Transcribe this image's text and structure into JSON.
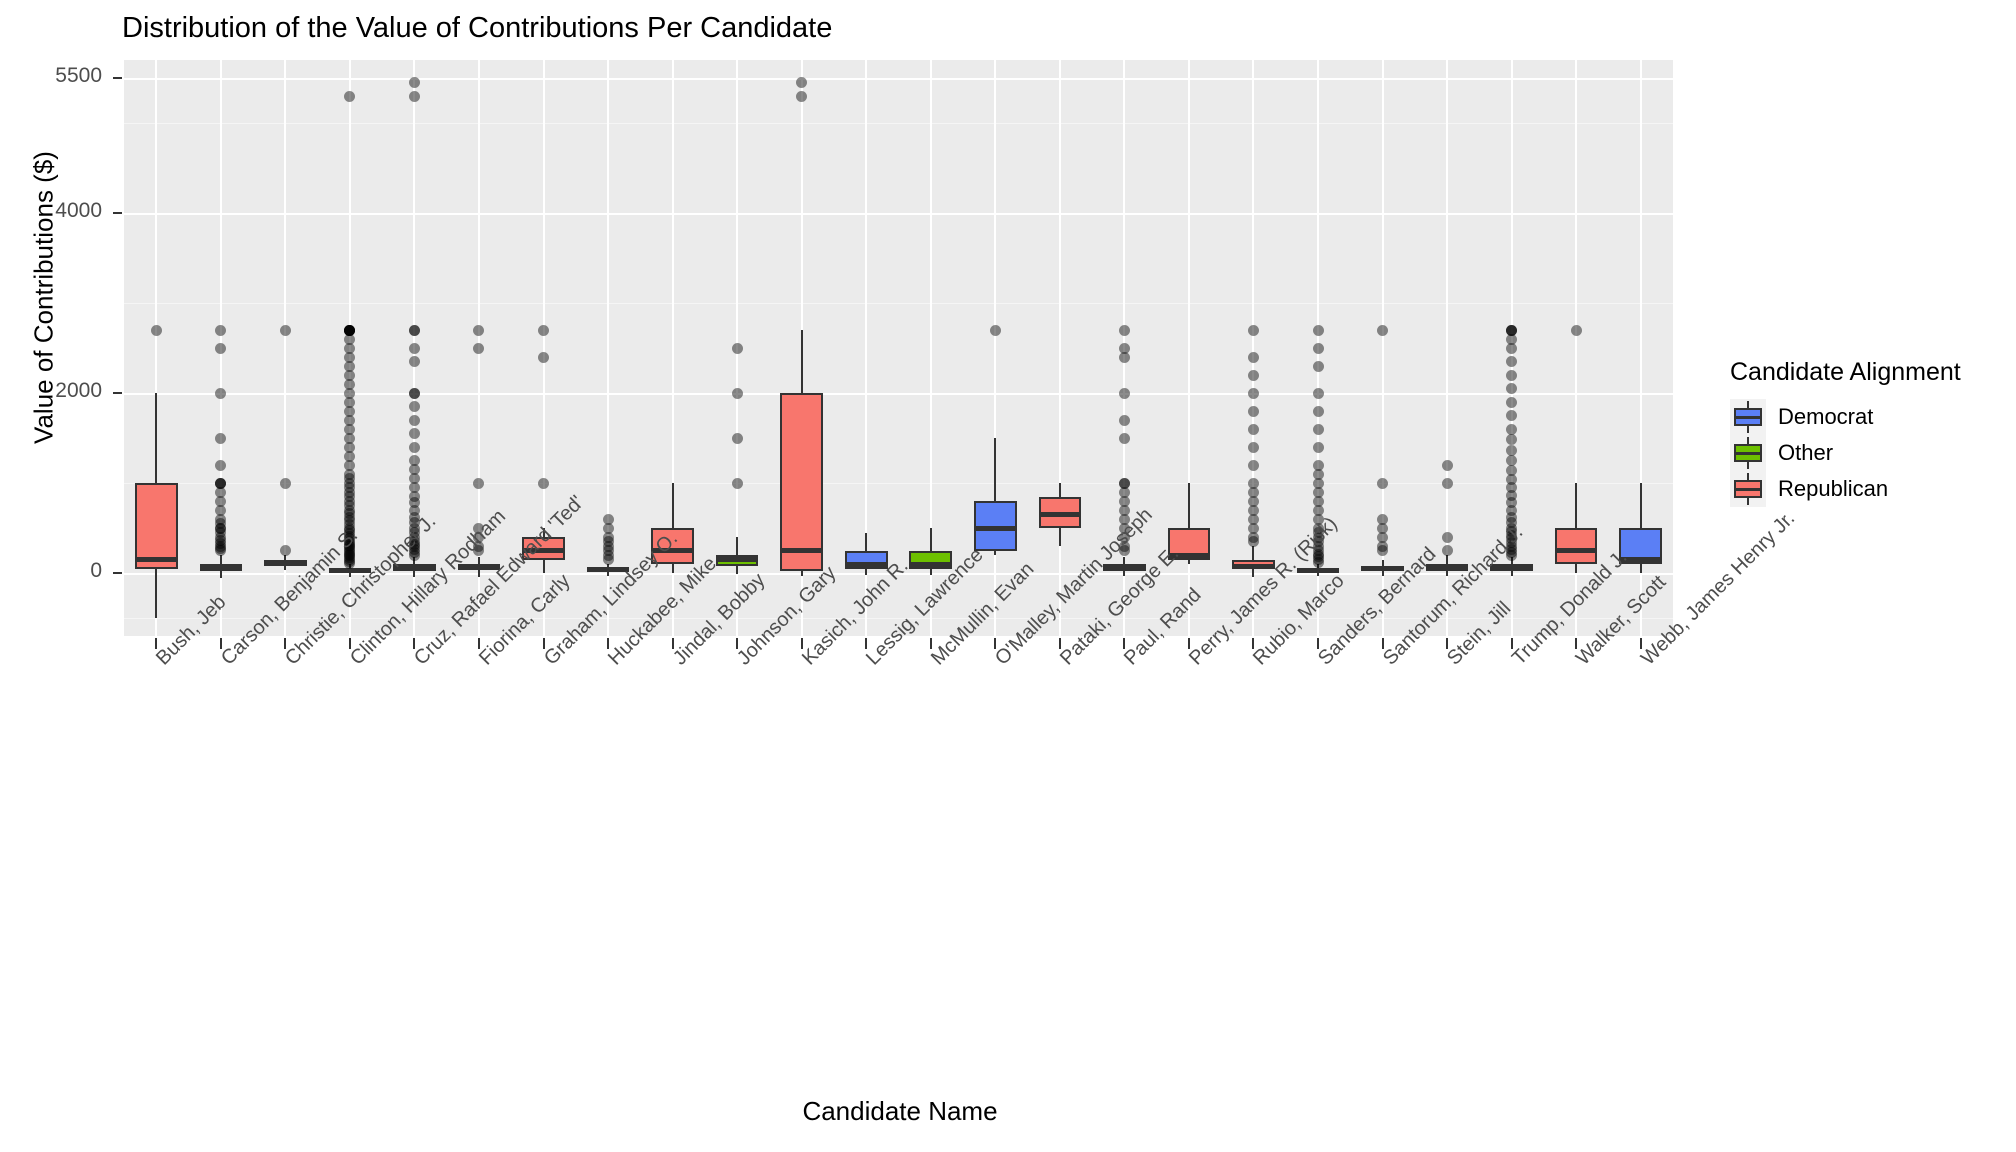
{
  "chart_data": {
    "type": "box",
    "title": "Distribution of the Value of Contributions Per Candidate",
    "xlabel": "Candidate Name",
    "ylabel": "Value of Contributions ($)",
    "ylim": [
      -700,
      5700
    ],
    "yticks": [
      0,
      2000,
      4000,
      5500
    ],
    "ytick_labels": [
      "0",
      "2000",
      "4000",
      "5500"
    ],
    "grid": true,
    "legend": {
      "title": "Candidate Alignment",
      "position": "right",
      "entries": [
        {
          "label": "Democrat",
          "color": "#5B7FF5"
        },
        {
          "label": "Other",
          "color": "#6DC000"
        },
        {
          "label": "Republican",
          "color": "#F8766D"
        }
      ]
    },
    "categories": [
      "Bush, Jeb",
      "Carson, Benjamin S.",
      "Christie, Christopher J.",
      "Clinton, Hillary Rodham",
      "Cruz, Rafael Edward 'Ted'",
      "Fiorina, Carly",
      "Graham, Lindsey O.",
      "Huckabee, Mike",
      "Jindal, Bobby",
      "Johnson, Gary",
      "Kasich, John R.",
      "Lessig, Lawrence",
      "McMullin, Evan",
      "O'Malley, Martin Joseph",
      "Pataki, George E.",
      "Paul, Rand",
      "Perry, James R. (Rick)",
      "Rubio, Marco",
      "Sanders, Bernard",
      "Santorum, Richard J.",
      "Stein, Jill",
      "Trump, Donald J.",
      "Walker, Scott",
      "Webb, James Henry Jr."
    ],
    "boxes": [
      {
        "category": "Bush, Jeb",
        "alignment": "Republican",
        "color": "#F8766D",
        "whisker_low": -500,
        "q1": 50,
        "median": 150,
        "q3": 1000,
        "whisker_high": 2000,
        "outliers": [
          2700
        ]
      },
      {
        "category": "Carson, Benjamin S.",
        "alignment": "Republican",
        "color": "#F8766D",
        "whisker_low": -60,
        "q1": 25,
        "median": 50,
        "q3": 100,
        "whisker_high": 200,
        "outliers": [
          250,
          270,
          300,
          330,
          360,
          400,
          450,
          500,
          500,
          550,
          600,
          700,
          800,
          900,
          1000,
          1000,
          1000,
          1200,
          1500,
          2000,
          2500,
          2700
        ]
      },
      {
        "category": "Christie, Christopher J.",
        "alignment": "Republican",
        "color": "#F8766D",
        "whisker_low": 35,
        "q1": 80,
        "median": 110,
        "q3": 150,
        "whisker_high": 200,
        "outliers": [
          250,
          1000,
          2700
        ]
      },
      {
        "category": "Clinton, Hillary Rodham",
        "alignment": "Democrat",
        "color": "#5B7FF5",
        "whisker_low": -45,
        "q1": 10,
        "median": 25,
        "q3": 50,
        "whisker_high": 100,
        "outliers": [
          110,
          130,
          150,
          170,
          190,
          210,
          230,
          250,
          270,
          290,
          310,
          330,
          350,
          380,
          410,
          440,
          470,
          500,
          540,
          580,
          620,
          660,
          700,
          750,
          800,
          850,
          900,
          950,
          1000,
          1050,
          1100,
          1200,
          1300,
          1400,
          1500,
          1600,
          1700,
          1800,
          1900,
          2000,
          2100,
          2200,
          2300,
          2400,
          2500,
          2600,
          2700,
          2700,
          2700,
          2700,
          2700,
          2700,
          2700,
          5300
        ]
      },
      {
        "category": "Cruz, Rafael Edward 'Ted'",
        "alignment": "Republican",
        "color": "#F8766D",
        "whisker_low": -40,
        "q1": 25,
        "median": 50,
        "q3": 100,
        "whisker_high": 175,
        "outliers": [
          200,
          230,
          260,
          290,
          320,
          350,
          400,
          450,
          500,
          560,
          620,
          700,
          780,
          850,
          950,
          1050,
          1150,
          1250,
          1400,
          1550,
          1700,
          1850,
          2000,
          2000,
          2350,
          2500,
          2700,
          2700,
          5300,
          5450
        ]
      },
      {
        "category": "Fiorina, Carly",
        "alignment": "Republican",
        "color": "#F8766D",
        "whisker_low": -40,
        "q1": 30,
        "median": 60,
        "q3": 100,
        "whisker_high": 175,
        "outliers": [
          250,
          300,
          400,
          500,
          1000,
          2500,
          2700
        ]
      },
      {
        "category": "Graham, Lindsey O.",
        "alignment": "Republican",
        "color": "#F8766D",
        "whisker_low": 0,
        "q1": 150,
        "median": 250,
        "q3": 400,
        "whisker_high": 500,
        "outliers": [
          1000,
          2400,
          2700
        ]
      },
      {
        "category": "Huckabee, Mike",
        "alignment": "Republican",
        "color": "#F8766D",
        "whisker_low": -30,
        "q1": 20,
        "median": 35,
        "q3": 60,
        "whisker_high": 100,
        "outliers": [
          150,
          200,
          250,
          300,
          350,
          400,
          500,
          600
        ]
      },
      {
        "category": "Jindal, Bobby",
        "alignment": "Republican",
        "color": "#F8766D",
        "whisker_low": 0,
        "q1": 100,
        "median": 250,
        "q3": 500,
        "whisker_high": 1000,
        "outliers": []
      },
      {
        "category": "Johnson, Gary",
        "alignment": "Other",
        "color": "#6DC000",
        "whisker_low": -10,
        "q1": 75,
        "median": 150,
        "q3": 200,
        "whisker_high": 400,
        "outliers": [
          1000,
          1500,
          2000,
          2500
        ]
      },
      {
        "category": "Kasich, John R.",
        "alignment": "Republican",
        "color": "#F8766D",
        "whisker_low": -30,
        "q1": 25,
        "median": 250,
        "q3": 2000,
        "whisker_high": 2700,
        "outliers": [
          5300,
          5450
        ]
      },
      {
        "category": "Lessig, Lawrence",
        "alignment": "Democrat",
        "color": "#5B7FF5",
        "whisker_low": -20,
        "q1": 50,
        "median": 100,
        "q3": 250,
        "whisker_high": 450,
        "outliers": []
      },
      {
        "category": "McMullin, Evan",
        "alignment": "Other",
        "color": "#6DC000",
        "whisker_low": -20,
        "q1": 50,
        "median": 100,
        "q3": 250,
        "whisker_high": 500,
        "outliers": []
      },
      {
        "category": "O'Malley, Martin Joseph",
        "alignment": "Democrat",
        "color": "#5B7FF5",
        "whisker_low": 200,
        "q1": 250,
        "median": 500,
        "q3": 800,
        "whisker_high": 1500,
        "outliers": [
          2700
        ]
      },
      {
        "category": "Pataki, George E.",
        "alignment": "Republican",
        "color": "#F8766D",
        "whisker_low": 300,
        "q1": 500,
        "median": 650,
        "q3": 850,
        "whisker_high": 1000,
        "outliers": []
      },
      {
        "category": "Paul, Rand",
        "alignment": "Republican",
        "color": "#F8766D",
        "whisker_low": -35,
        "q1": 25,
        "median": 50,
        "q3": 100,
        "whisker_high": 175,
        "outliers": [
          250,
          300,
          400,
          500,
          600,
          700,
          800,
          900,
          1000,
          1000,
          1500,
          1700,
          2000,
          2400,
          2500,
          2700
        ]
      },
      {
        "category": "Perry, James R. (Rick)",
        "alignment": "Republican",
        "color": "#F8766D",
        "whisker_low": 100,
        "q1": 150,
        "median": 200,
        "q3": 500,
        "whisker_high": 1000,
        "outliers": []
      },
      {
        "category": "Rubio, Marco",
        "alignment": "Republican",
        "color": "#F8766D",
        "whisker_low": -40,
        "q1": 40,
        "median": 75,
        "q3": 150,
        "whisker_high": 300,
        "outliers": [
          350,
          400,
          500,
          600,
          700,
          800,
          900,
          1000,
          1200,
          1400,
          1600,
          1800,
          2000,
          2200,
          2400,
          2700
        ]
      },
      {
        "category": "Sanders, Bernard",
        "alignment": "Democrat",
        "color": "#5B7FF5",
        "whisker_low": -30,
        "q1": 15,
        "median": 27,
        "q3": 50,
        "whisker_high": 100,
        "outliers": [
          120,
          150,
          180,
          210,
          250,
          300,
          350,
          400,
          450,
          500,
          600,
          700,
          800,
          900,
          1000,
          1100,
          1200,
          1400,
          1600,
          1800,
          2000,
          2300,
          2500,
          2700
        ]
      },
      {
        "category": "Santorum, Richard J.",
        "alignment": "Republican",
        "color": "#F8766D",
        "whisker_low": -35,
        "q1": 25,
        "median": 50,
        "q3": 80,
        "whisker_high": 150,
        "outliers": [
          250,
          300,
          400,
          500,
          600,
          1000,
          2700
        ]
      },
      {
        "category": "Stein, Jill",
        "alignment": "Other",
        "color": "#6DC000",
        "whisker_low": -30,
        "q1": 30,
        "median": 50,
        "q3": 100,
        "whisker_high": 200,
        "outliers": [
          250,
          400,
          1000,
          1200
        ]
      },
      {
        "category": "Trump, Donald J.",
        "alignment": "Republican",
        "color": "#F8766D",
        "whisker_low": -35,
        "q1": 25,
        "median": 50,
        "q3": 100,
        "whisker_high": 175,
        "outliers": [
          200,
          230,
          260,
          300,
          340,
          380,
          420,
          460,
          500,
          560,
          620,
          700,
          780,
          860,
          950,
          1040,
          1140,
          1250,
          1360,
          1480,
          1600,
          1750,
          1900,
          2050,
          2200,
          2350,
          2500,
          2600,
          2700,
          2700,
          2700
        ]
      },
      {
        "category": "Walker, Scott",
        "alignment": "Republican",
        "color": "#F8766D",
        "whisker_low": 0,
        "q1": 100,
        "median": 250,
        "q3": 500,
        "whisker_high": 1000,
        "outliers": [
          2700
        ]
      },
      {
        "category": "Webb, James Henry Jr.",
        "alignment": "Democrat",
        "color": "#5B7FF5",
        "whisker_low": 0,
        "q1": 100,
        "median": 150,
        "q3": 500,
        "whisker_high": 1000,
        "outliers": []
      }
    ]
  }
}
